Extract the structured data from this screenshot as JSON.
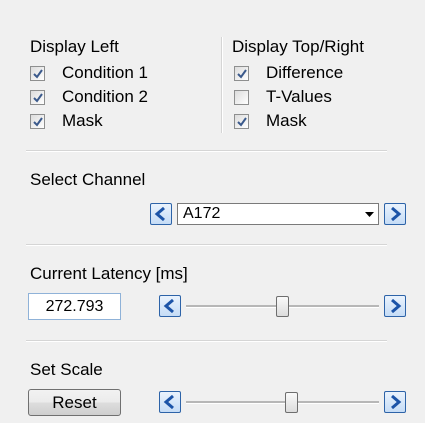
{
  "display_left": {
    "title": "Display Left",
    "items": [
      {
        "label": "Condition 1",
        "checked": true
      },
      {
        "label": "Condition 2",
        "checked": true
      },
      {
        "label": "Mask",
        "checked": true
      }
    ]
  },
  "display_right": {
    "title": "Display Top/Right",
    "items": [
      {
        "label": "Difference",
        "checked": true
      },
      {
        "label": "T-Values",
        "checked": false
      },
      {
        "label": "Mask",
        "checked": true
      }
    ]
  },
  "channel": {
    "title": "Select Channel",
    "selected": "A172"
  },
  "latency": {
    "title": "Current Latency [ms]",
    "value": "272.793",
    "slider_fraction": 0.5
  },
  "scale": {
    "title": "Set Scale",
    "reset_label": "Reset",
    "slider_fraction": 0.55
  },
  "colors": {
    "check": "#3b5a8c",
    "arrow": "#1c54a8"
  }
}
